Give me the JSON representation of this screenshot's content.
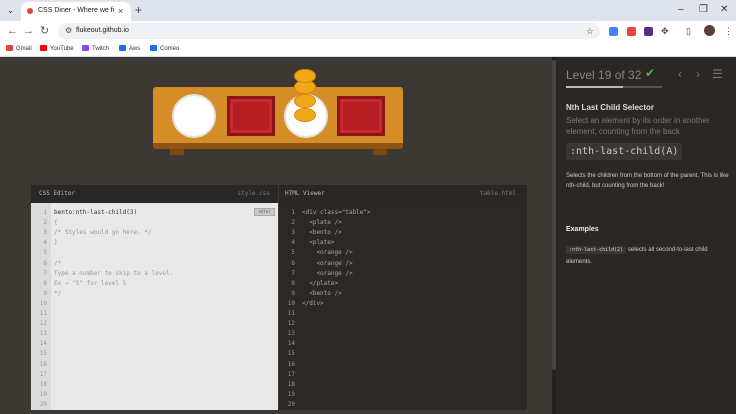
{
  "browser": {
    "tab_menu_icon": "chevron-down-icon",
    "tab_title": "CSS Diner - Where we feast on",
    "tab_close": "×",
    "new_tab": "+",
    "window_controls": {
      "minimize": "–",
      "restore": "❐",
      "close": "✕"
    },
    "nav": {
      "back": "←",
      "forward": "→",
      "reload": "↻"
    },
    "url": "flukeout.github.io",
    "star": "☆",
    "bookmarks": [
      {
        "label": "Gmail",
        "color": "#ea4335"
      },
      {
        "label": "YouTube",
        "color": "#ff0000"
      },
      {
        "label": "Twitch",
        "color": "#9146ff"
      },
      {
        "label": "Aws",
        "color": "#1a73e8"
      },
      {
        "label": "Comeo",
        "color": "#1a73e8"
      }
    ],
    "extension_colors": [
      "#4285f4",
      "#e8453c",
      "#5b2c8a"
    ],
    "menu_dots": "⋮"
  },
  "editors": {
    "css": {
      "title": "CSS Editor",
      "file": "style.css",
      "line_numbers": [
        "1",
        "2",
        "3",
        "4",
        "5",
        "6",
        "7",
        "8",
        "9",
        "10",
        "11",
        "12",
        "13",
        "14",
        "15",
        "16",
        "17",
        "18",
        "19",
        "20"
      ],
      "input": "bento:nth-last-child(3)",
      "lines": [
        "{",
        "/* Styles would go here. */",
        "}",
        "",
        "/*",
        "Type a number to skip to a level.",
        "Ex → \"5\" for level 5",
        "*/"
      ],
      "enter_label": "enter"
    },
    "html": {
      "title": "HTML Viewer",
      "file": "table.html",
      "line_numbers": [
        "1",
        "2",
        "3",
        "4",
        "5",
        "6",
        "7",
        "8",
        "9",
        "10",
        "11",
        "12",
        "13",
        "14",
        "15",
        "16",
        "17",
        "18",
        "19",
        "20"
      ],
      "lines": [
        "<div class=\"table\">",
        "  <plate />",
        "  <bento />",
        "  <plate>",
        "    <orange />",
        "    <orange />",
        "    <orange />",
        "  </plate>",
        "  <bento />",
        "</div>"
      ]
    }
  },
  "sidebar": {
    "level_title": "Level 19 of 32",
    "check": "✔",
    "progress": 0.59,
    "prev": "‹",
    "next": "›",
    "menu": "☰",
    "heading": "Nth Last Child Selector",
    "syntax_desc": "Select an element by its order in another element, counting from the back",
    "selector": ":nth-last-child(A)",
    "description": "Selects the children from the bottom of the parent. This is like nth-child, but counting from the back!",
    "examples_title": "Examples",
    "example_code": ":nth-last-child(2)",
    "example_text": " selects all second-to-last child elements."
  },
  "colors": {
    "table": "#d58d27",
    "bento": "#b51e23",
    "orange": "#f2a816",
    "check": "#4caf50"
  }
}
